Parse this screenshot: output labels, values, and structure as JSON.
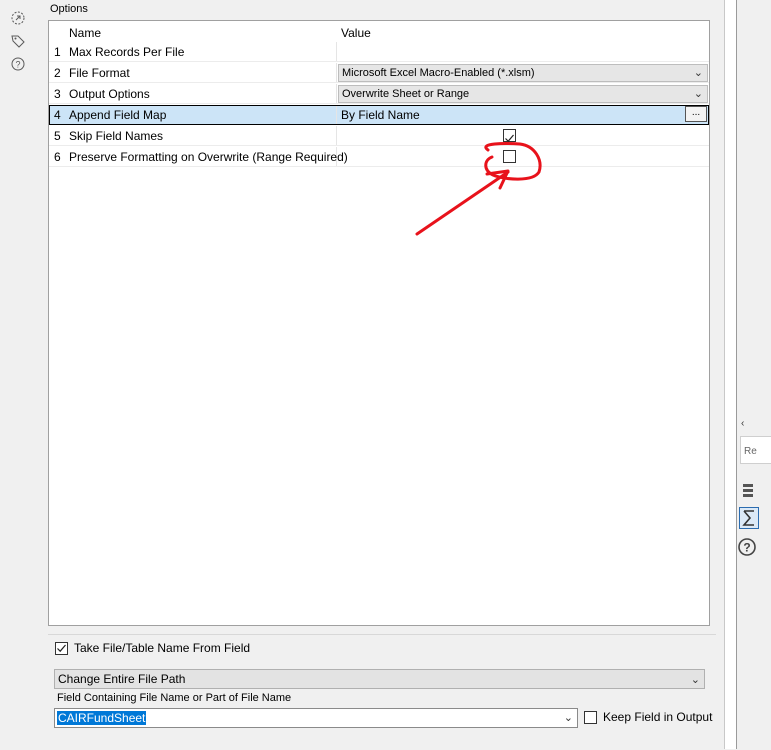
{
  "section": {
    "title": "Options"
  },
  "grid": {
    "headers": {
      "name": "Name",
      "value": "Value"
    },
    "rows": [
      {
        "num": "1",
        "name": "Max Records Per File",
        "value": ""
      },
      {
        "num": "2",
        "name": "File Format",
        "value": "Microsoft Excel Macro-Enabled (*.xlsm)"
      },
      {
        "num": "3",
        "name": "Output Options",
        "value": "Overwrite Sheet or Range"
      },
      {
        "num": "4",
        "name": "Append Field Map",
        "value": "By Field Name",
        "button": "..."
      },
      {
        "num": "5",
        "name": "Skip Field Names",
        "checked": true
      },
      {
        "num": "6",
        "name": "Preserve Formatting on Overwrite (Range Required)",
        "checked": false
      }
    ]
  },
  "bottom": {
    "take_label": "Take File/Table Name From Field",
    "take_checked": true,
    "mode_value": "Change Entire File Path",
    "field_label": "Field Containing File Name or Part of File Name",
    "field_value": "CAIRFundSheet",
    "keep_label": "Keep Field in Output",
    "keep_checked": false
  },
  "right_panel": {
    "search_text": "Re"
  },
  "icons": [
    "connection-icon",
    "tag-icon",
    "help-icon",
    "database-icon",
    "sigma-icon",
    "help-icon-right"
  ],
  "colors": {
    "selection": "#cce4f7",
    "annotation": "#e8121b",
    "text_highlight": "#0078d7"
  }
}
